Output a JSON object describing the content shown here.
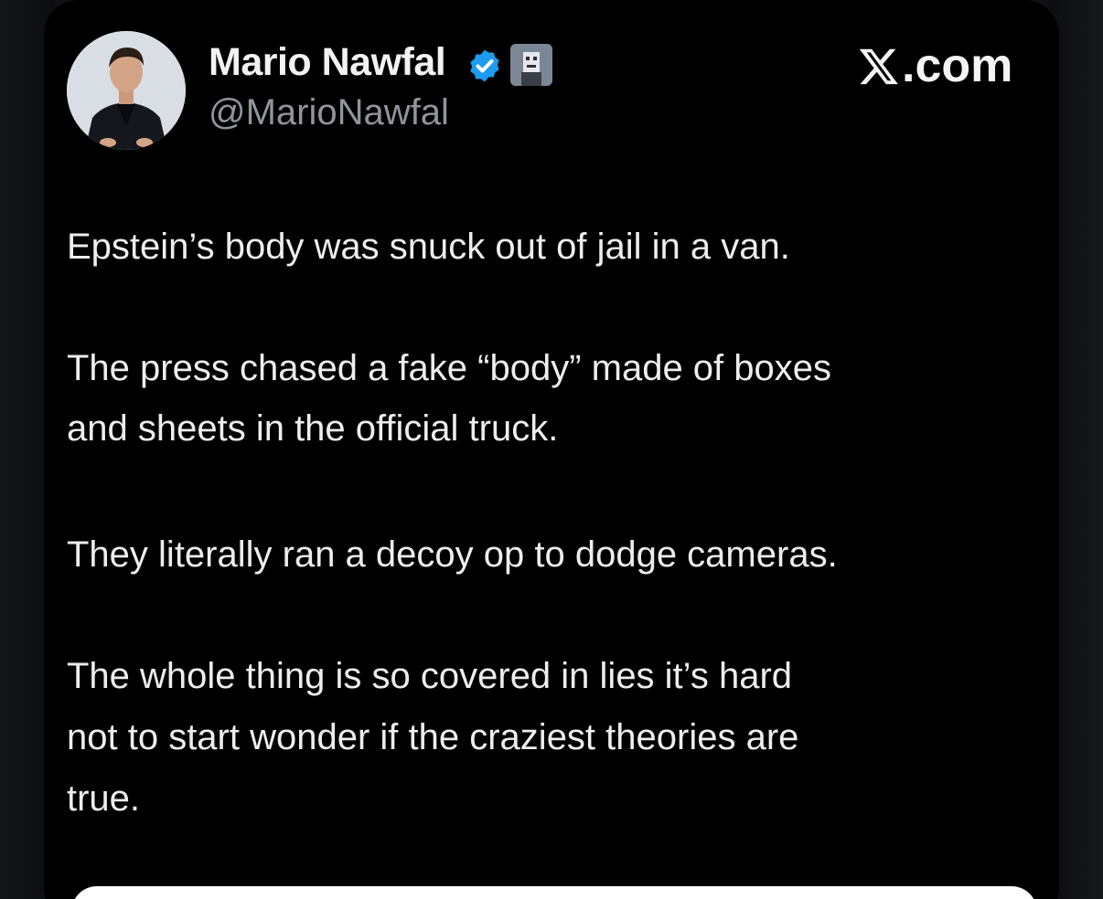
{
  "author": {
    "display_name": "Mario Nawfal",
    "handle": "@MarioNawfal",
    "verified_icon": "verified-check-icon",
    "affiliate_icon": "affiliate-badge-icon",
    "verified_color": "#1d9bf0"
  },
  "source": {
    "site": ".com",
    "logo_icon": "x-logo-icon"
  },
  "tweet": {
    "lines": [
      "Epstein’s body was snuck out of jail in a van.",
      "The press chased a fake “body” made of boxes",
      "and sheets in the official truck.",
      "They literally ran a decoy op to dodge cameras.",
      "The whole thing is so covered in lies it’s hard",
      "not to start wonder if the craziest theories are",
      "true."
    ]
  },
  "colors": {
    "card_background": "#000000",
    "text_primary": "#ededed",
    "text_secondary": "#8f959b"
  }
}
